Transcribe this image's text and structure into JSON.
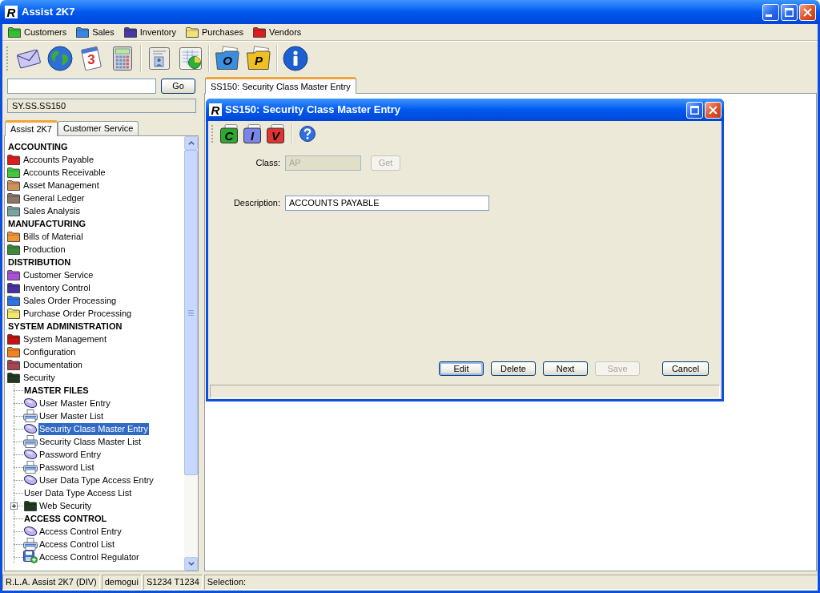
{
  "window": {
    "logo": "R",
    "title": "Assist 2K7"
  },
  "menu": [
    {
      "label": "Customers",
      "color": "#34c034"
    },
    {
      "label": "Sales",
      "color": "#3a86e8"
    },
    {
      "label": "Inventory",
      "color": "#4a3aa8"
    },
    {
      "label": "Purchases",
      "color": "#f2e27a"
    },
    {
      "label": "Vendors",
      "color": "#dc1e1e"
    }
  ],
  "toolbar": [
    {
      "items": [
        {
          "kind": "mail"
        },
        {
          "kind": "globe"
        },
        {
          "kind": "calendar",
          "letter": "3"
        },
        {
          "kind": "calculator"
        }
      ]
    },
    {
      "items": [
        {
          "kind": "form"
        },
        {
          "kind": "sheet"
        }
      ]
    },
    {
      "items": [
        {
          "kind": "folder",
          "letter": "O",
          "color": "#3a8ee0"
        },
        {
          "kind": "folder",
          "letter": "P",
          "color": "#f0c020"
        }
      ]
    },
    {
      "items": [
        {
          "kind": "info"
        }
      ]
    }
  ],
  "quick_go": {
    "button": "Go",
    "path": "SY.SS.SS150"
  },
  "nav_tabs": [
    {
      "label": "Assist 2K7",
      "selected": true
    },
    {
      "label": "Customer Service",
      "selected": false
    }
  ],
  "tree": {
    "items": [
      {
        "kind": "header",
        "label": "ACCOUNTING",
        "selected": false
      },
      {
        "kind": "folder",
        "label": "Accounts Payable",
        "color": "#e01c1c",
        "selected": false
      },
      {
        "kind": "folder",
        "label": "Accounts Receivable",
        "color": "#44c83c",
        "selected": false
      },
      {
        "kind": "folder",
        "label": "Asset Management",
        "color": "#d0905a",
        "selected": false
      },
      {
        "kind": "folder",
        "label": "General Ledger",
        "color": "#8c7466",
        "selected": false
      },
      {
        "kind": "folder",
        "label": "Sales Analysis",
        "color": "#7aa3a3",
        "selected": false
      },
      {
        "kind": "header",
        "label": "MANUFACTURING",
        "selected": false
      },
      {
        "kind": "folder",
        "label": "Bills of Material",
        "color": "#f09434",
        "selected": false
      },
      {
        "kind": "folder",
        "label": "Production",
        "color": "#3d8a3d",
        "selected": false
      },
      {
        "kind": "header",
        "label": "DISTRIBUTION",
        "selected": false
      },
      {
        "kind": "folder",
        "label": "Customer Service",
        "color": "#a552d6",
        "selected": false
      },
      {
        "kind": "folder",
        "label": "Inventory Control",
        "color": "#4532a3",
        "selected": false
      },
      {
        "kind": "folder",
        "label": "Sales Order Processing",
        "color": "#2d74e2",
        "selected": false
      },
      {
        "kind": "folder",
        "label": "Purchase Order Processing",
        "color": "#f4e86a",
        "selected": false
      },
      {
        "kind": "header",
        "label": "SYSTEM ADMINISTRATION",
        "selected": false
      },
      {
        "kind": "folder",
        "label": "System Management",
        "color": "#c41212",
        "selected": false
      },
      {
        "kind": "folder",
        "label": "Configuration",
        "color": "#f28222",
        "selected": false
      },
      {
        "kind": "folder",
        "label": "Documentation",
        "color": "#a84552",
        "selected": false
      },
      {
        "kind": "folder",
        "label": "Security",
        "color": "#1f3a1f",
        "selected": false,
        "children": [
          {
            "kind": "header",
            "label": "MASTER FILES",
            "selected": false
          },
          {
            "kind": "entry",
            "label": "User Master Entry",
            "selected": false
          },
          {
            "kind": "list",
            "label": "User Master List",
            "selected": false
          },
          {
            "kind": "entry",
            "label": "Security Class Master Entry",
            "selected": true
          },
          {
            "kind": "list",
            "label": "Security Class Master List",
            "selected": false
          },
          {
            "kind": "entry",
            "label": "Password Entry",
            "selected": false
          },
          {
            "kind": "list",
            "label": "Password List",
            "selected": false
          },
          {
            "kind": "entry",
            "label": "User Data Type Access Entry",
            "selected": false
          },
          {
            "kind": "plain",
            "label": "User Data Type Access List",
            "selected": false
          },
          {
            "kind": "folder",
            "label": "Web Security",
            "color": "#1f3a1f",
            "expanded": false,
            "selected": false
          },
          {
            "kind": "header",
            "label": "ACCESS CONTROL",
            "selected": false
          },
          {
            "kind": "entry",
            "label": "Access Control Entry",
            "selected": false
          },
          {
            "kind": "list",
            "label": "Access Control List",
            "selected": false
          },
          {
            "kind": "regulator",
            "label": "Access Control Regulator",
            "selected": false
          }
        ]
      }
    ]
  },
  "document_tabs": [
    {
      "label": "SS150: Security Class Master Entry",
      "selected": true
    }
  ],
  "dialog": {
    "logo": "R",
    "title": "SS150: Security Class Master Entry",
    "toolbar": [
      {
        "kind": "doc",
        "letter": "C",
        "color": "#30a830"
      },
      {
        "kind": "doc",
        "letter": "I",
        "color": "#7a86e6"
      },
      {
        "kind": "doc",
        "letter": "V",
        "color": "#e03434"
      },
      {
        "kind": "help"
      }
    ],
    "fields": [
      {
        "label": "Class:",
        "value": "AP",
        "disabled": true,
        "button": {
          "label": "Get",
          "disabled": true
        }
      },
      {
        "label": "Description:",
        "value": "ACCOUNTS PAYABLE",
        "disabled": false
      }
    ],
    "actions": [
      {
        "label": "Edit",
        "disabled": false,
        "focused": true
      },
      {
        "label": "Delete",
        "disabled": false,
        "focused": false
      },
      {
        "label": "Next",
        "disabled": false,
        "focused": false
      },
      {
        "label": "Save",
        "disabled": true,
        "focused": false
      }
    ],
    "cancel": {
      "label": "Cancel"
    }
  },
  "status_bar": [
    "R.L.A. Assist 2K7 (DIV)",
    "demogui",
    "S1234 T1234",
    "Selection:"
  ]
}
